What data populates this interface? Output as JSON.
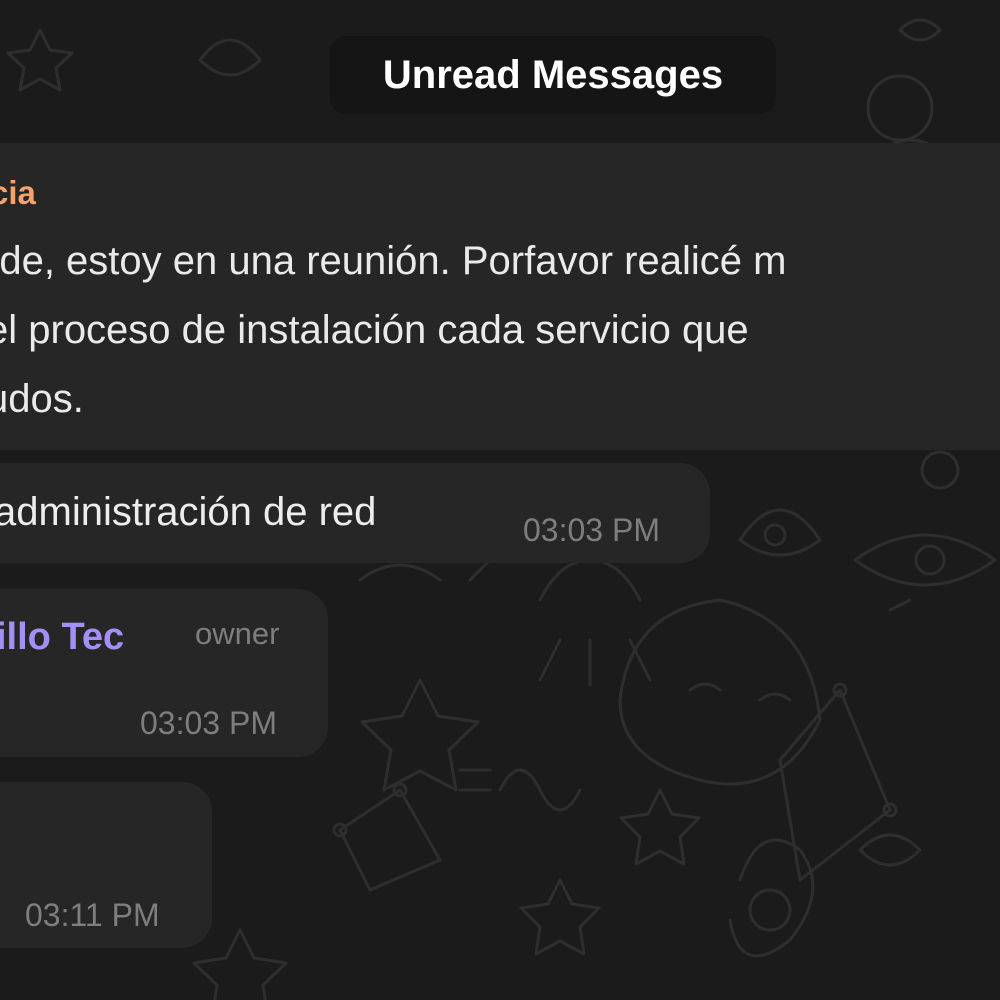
{
  "unread_banner": {
    "label": "Unread Messages"
  },
  "quoted_message": {
    "sender": "cia",
    "lines": [
      "rde, estoy en una reunión. Porfavor realicé m",
      "el proceso de instalación cada servicio que",
      "udos."
    ]
  },
  "messages": [
    {
      "text": "administración de red",
      "time": "03:03 PM"
    },
    {
      "sender": "illo Tec",
      "role": "owner",
      "time": "03:03 PM"
    },
    {
      "time": "03:11 PM"
    }
  ]
}
